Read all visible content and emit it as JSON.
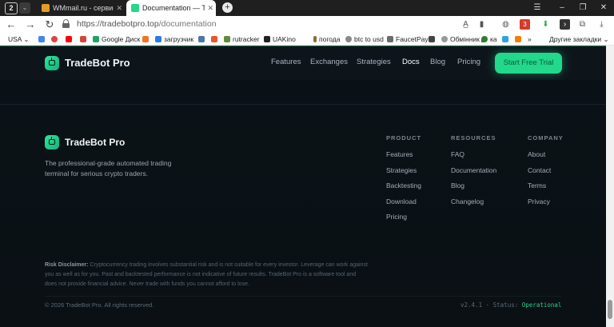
{
  "browser": {
    "tab_count": "2",
    "tabs": [
      {
        "title": "WMmail.ru - сервис почто",
        "active": false
      },
      {
        "title": "Documentation — Trad",
        "active": true
      }
    ],
    "url_host": "https://tradebotpro.top",
    "url_path": "/documentation",
    "bookmarks": [
      "USA",
      "Google Диск",
      "загрузчик",
      "rutracker",
      "UAKino",
      "погода",
      "btc to usd",
      "FaucetPay",
      "Обмінник",
      "ка"
    ],
    "other_bookmarks": "Другие закладки",
    "badge_count": "3"
  },
  "site": {
    "brand": "TradeBot Pro",
    "nav": [
      {
        "label": "Features",
        "active": false
      },
      {
        "label": "Exchanges",
        "active": false
      },
      {
        "label": "Strategies",
        "active": false
      },
      {
        "label": "Docs",
        "active": true
      },
      {
        "label": "Blog",
        "active": false
      },
      {
        "label": "Pricing",
        "active": false
      }
    ],
    "cta": "Start Free Trial",
    "accent_color": "#22d88a"
  },
  "footer": {
    "brand": "TradeBot Pro",
    "tagline": "The professional-grade automated trading terminal for serious crypto traders.",
    "columns": [
      {
        "heading": "PRODUCT",
        "links": [
          "Features",
          "Strategies",
          "Backtesting",
          "Download",
          "Pricing"
        ]
      },
      {
        "heading": "RESOURCES",
        "links": [
          "FAQ",
          "Documentation",
          "Blog",
          "Changelog"
        ]
      },
      {
        "heading": "COMPANY",
        "links": [
          "About",
          "Contact",
          "Terms",
          "Privacy"
        ]
      }
    ],
    "disclaimer_label": "Risk Disclaimer:",
    "disclaimer_text": "Cryptocurrency trading involves substantial risk and is not suitable for every investor. Leverage can work against you as well as for you. Past and backtested performance is not indicative of future results. TradeBot Pro is a software tool and does not provide financial advice. Never trade with funds you cannot afford to lose.",
    "copyright": "© 2026 TradeBot Pro. All rights reserved.",
    "version": "v2.4.1",
    "status_label": "Status:",
    "status_value": "Operational"
  }
}
